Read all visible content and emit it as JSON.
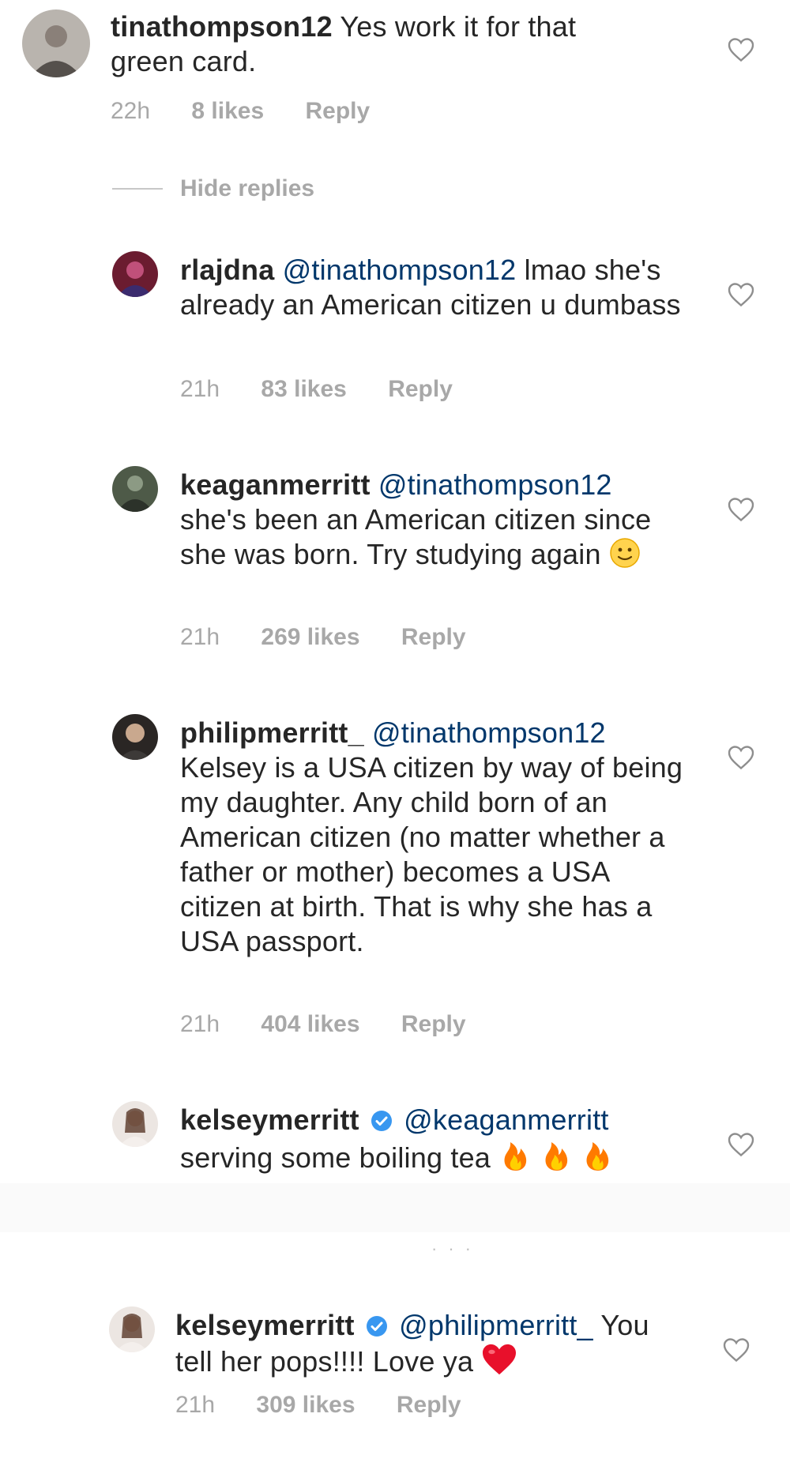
{
  "comments": [
    {
      "username": "tinathompson12",
      "mention": "",
      "text": "Yes work it for that green card.",
      "time": "22h",
      "likes": "8 likes",
      "reply": "Reply"
    },
    {
      "username": "rlajdna",
      "mention": "@tinathompson12",
      "text": "lmao she's already an American citizen u dumbass",
      "time": "21h",
      "likes": "83 likes",
      "reply": "Reply"
    },
    {
      "username": "keaganmerritt",
      "mention": "@tinathompson12",
      "text": "she's been an American citizen since she was born. Try studying again",
      "emoji": "slightly-smiling-face",
      "time": "21h",
      "likes": "269 likes",
      "reply": "Reply"
    },
    {
      "username": "philipmerritt_",
      "mention": "@tinathompson12",
      "text": "Kelsey is a USA citizen by way of being my daughter. Any child born of an American citizen (no matter whether a father or mother) becomes a USA citizen at birth. That is why she has a USA passport.",
      "time": "21h",
      "likes": "404 likes",
      "reply": "Reply"
    },
    {
      "username": "kelseymerritt",
      "verified": true,
      "mention": "@keaganmerritt",
      "text": "serving some boiling tea",
      "emoji": "fire-x3",
      "time": "",
      "likes": "",
      "reply": ""
    },
    {
      "username": "kelseymerritt",
      "verified": true,
      "mention": "@philipmerritt_",
      "text": "You tell her pops!!!! Love ya",
      "emoji": "red-heart",
      "time": "21h",
      "likes": "309 likes",
      "reply": "Reply"
    }
  ],
  "hide_replies": "Hide replies",
  "icons": {
    "like": "heart-outline-icon",
    "verified": "verified-badge-icon"
  },
  "colors": {
    "mention": "#00376b",
    "meta": "#a8a8a8",
    "verified": "#3897f0",
    "fire": "#ff7a00",
    "heart": "#e8102b"
  }
}
